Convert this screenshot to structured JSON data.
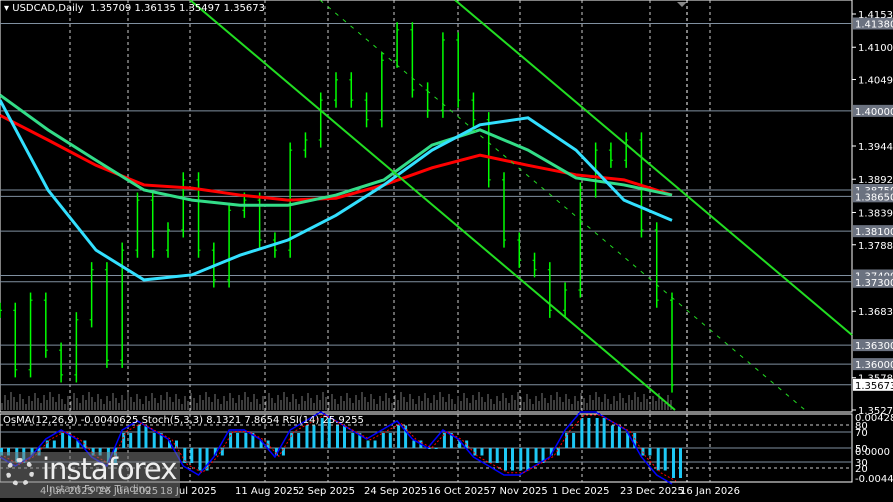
{
  "header": {
    "symbol": "USDCAD,Daily",
    "open": "1.35709",
    "high": "1.36135",
    "low": "1.35497",
    "close": "1.35673"
  },
  "indicators": {
    "label": "OsMA(12,26,9) -0.0040625  Stoch(5,3,3) 8.1321 7.8654  RSI(14) 25.9255"
  },
  "watermark": {
    "brand": "instaforex",
    "tagline": "Instant Forex Trading"
  },
  "colors": {
    "bull": "#00ff00",
    "ma200": "#ff0000",
    "ma100": "#33dd88",
    "ma50": "#33e0ff",
    "level": "#8090a0",
    "osma": "#1ec8f5"
  },
  "chart_data": {
    "type": "line",
    "title": "USDCAD,Daily",
    "ylim": [
      1.35275,
      1.4153
    ],
    "price_ticks": [
      "1.41530",
      "1.41005",
      "1.40495",
      "1.39445",
      "1.38920",
      "1.38395",
      "1.37885",
      "1.36835",
      "1.35785",
      "1.35275"
    ],
    "levels": [
      "1.41380",
      "1.40000",
      "1.38750",
      "1.38650",
      "1.38100",
      "1.37400",
      "1.37300",
      "1.36300",
      "1.36000"
    ],
    "current_price": "1.35673",
    "date_ticks": [
      "4 Jun 2025",
      "26 Jun 2025",
      "18 Jul 2025",
      "11 Aug 2025",
      "2 Sep 2025",
      "24 Sep 2025",
      "16 Oct 2025",
      "7 Nov 2025",
      "1 Dec 2025",
      "23 Dec 2025",
      "16 Jan 2026"
    ],
    "closes": [
      1.3685,
      1.3591,
      1.3701,
      1.3622,
      1.3583,
      1.367,
      1.3749,
      1.3606,
      1.378,
      1.3859,
      1.378,
      1.3812,
      1.3891,
      1.378,
      1.3733,
      1.3843,
      1.3859,
      1.3796,
      1.378,
      1.3938,
      1.3954,
      1.4017,
      1.4049,
      1.4017,
      1.3986,
      1.408,
      1.4128,
      1.4033,
      1.4001,
      1.4112,
      1.4017,
      1.3986,
      1.3891,
      1.3796,
      1.3764,
      1.3749,
      1.3685,
      1.3717,
      1.3875,
      1.3938,
      1.3922,
      1.3954,
      1.3812,
      1.3701,
      1.3567
    ],
    "series": [
      {
        "name": "MA200",
        "values": [
          1.3993,
          1.3954,
          1.3914,
          1.3883,
          1.3878,
          1.3867,
          1.3859,
          1.3862,
          1.3883,
          1.391,
          1.393,
          1.3914,
          1.3899,
          1.3891,
          1.3867
        ]
      },
      {
        "name": "MA100",
        "values": [
          1.4025,
          1.397,
          1.3922,
          1.3875,
          1.3859,
          1.3851,
          1.3851,
          1.3867,
          1.3891,
          1.3946,
          1.397,
          1.3938,
          1.3894,
          1.3883,
          1.3867
        ]
      },
      {
        "name": "MA50",
        "values": [
          1.4017,
          1.3875,
          1.378,
          1.3733,
          1.3741,
          1.3772,
          1.3796,
          1.3835,
          1.3883,
          1.3938,
          1.3978,
          1.3989,
          1.3938,
          1.3859,
          1.3827
        ]
      }
    ],
    "sub_ticks": [
      "0.004285",
      "80",
      "70",
      "50",
      "0.0000",
      "30",
      "20",
      "-0.00446"
    ],
    "osma": [
      -0.001,
      -0.002,
      -0.001,
      0.001,
      0.002,
      0.001,
      -0.001,
      -0.002,
      0.002,
      0.003,
      0.002,
      0.001,
      -0.002,
      -0.003,
      -0.001,
      0.002,
      0.002,
      0.001,
      -0.001,
      0.002,
      0.003,
      0.004,
      0.003,
      0.002,
      0.001,
      0.002,
      0.003,
      0.001,
      0,
      0.002,
      0.001,
      -0.001,
      -0.002,
      -0.003,
      -0.003,
      -0.002,
      -0.001,
      0.002,
      0.004,
      0.004,
      0.003,
      0.002,
      -0.001,
      -0.003,
      -0.004
    ]
  }
}
